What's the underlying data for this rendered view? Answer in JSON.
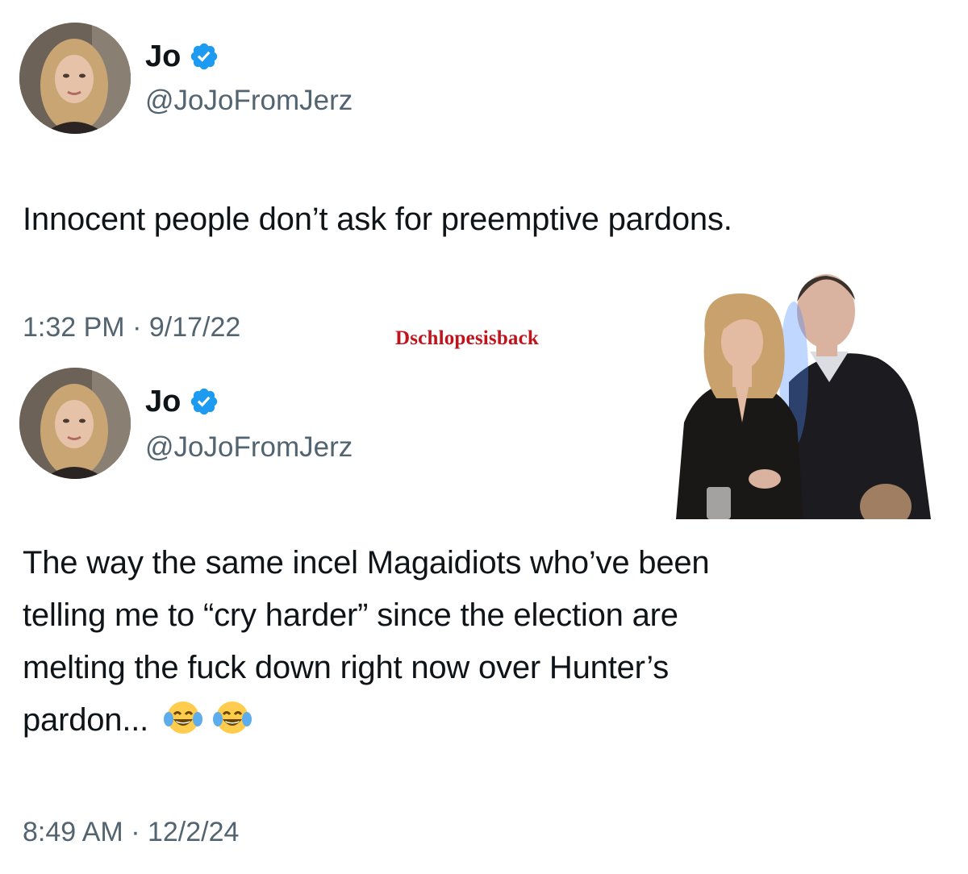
{
  "tweet1": {
    "display_name": "Jo",
    "handle": "@JoJoFromJerz",
    "verified_icon": "verified-badge-icon",
    "text": "Innocent people don’t ask for preemptive pardons.",
    "timestamp": "1:32 PM · 9/17/22"
  },
  "watermark": "Dschlopesisback",
  "tweet2": {
    "display_name": "Jo",
    "handle": "@JoJoFromJerz",
    "verified_icon": "verified-badge-icon",
    "text_lines": [
      "The way the same incel Magaidiots who’ve been",
      "telling me to “cry harder” since the election are",
      "melting the fuck down right now over Hunter’s",
      "pardon..."
    ],
    "emojis": [
      "face-with-tears-of-joy-icon",
      "face-with-tears-of-joy-icon"
    ],
    "timestamp": "8:49 AM · 12/2/24"
  },
  "colors": {
    "text": "#0f1419",
    "secondary": "#536471",
    "verified": "#1d9bf0",
    "watermark": "#c4121b"
  }
}
